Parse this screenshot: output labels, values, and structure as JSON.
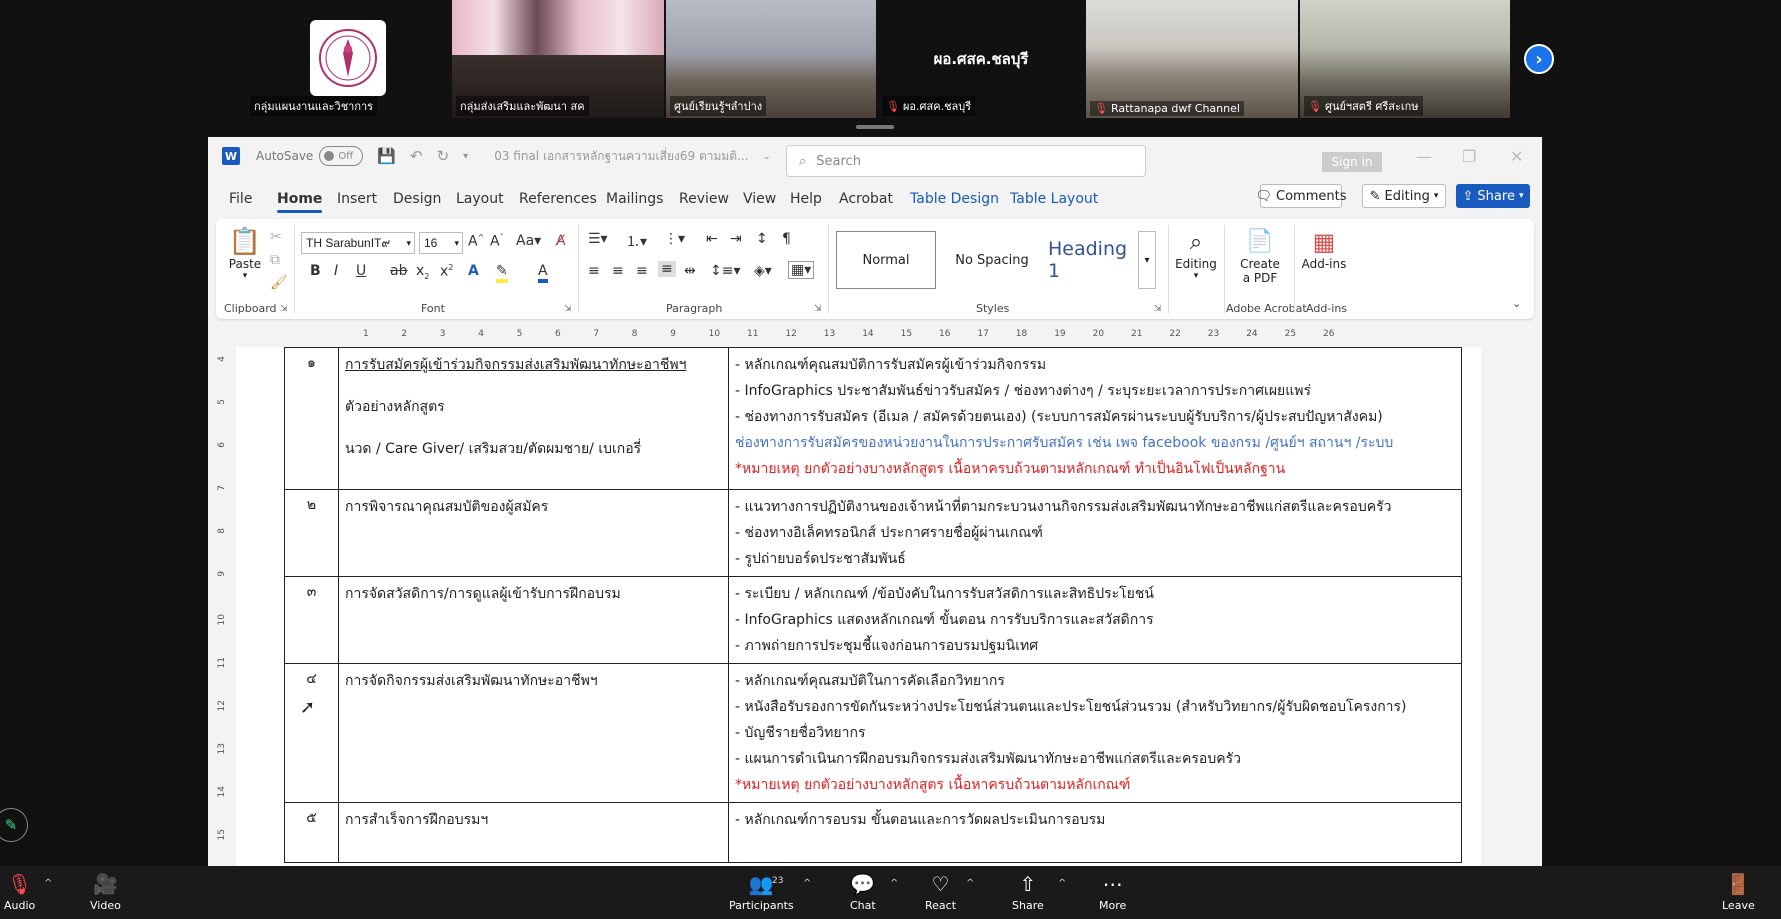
{
  "zoom": {
    "participants": [
      {
        "name": "กลุ่มแผนงานและวิชาการ",
        "muted": false,
        "kind": "logo"
      },
      {
        "name": "กลุ่มส่งเสริมและพัฒนา สค",
        "muted": false,
        "kind": "video",
        "active": true
      },
      {
        "name": "ศูนย์เรียนรู้ฯลำปาง",
        "muted": false,
        "kind": "video"
      },
      {
        "name": "ผอ.ศสค.ชลบุรี",
        "muted": true,
        "kind": "name",
        "display": "ผอ.ศสค.ชลบุรี"
      },
      {
        "name": "Rattanapa dwf Channel",
        "muted": true,
        "kind": "video"
      },
      {
        "name": "ศูนย์ฯสตรี ศรีสะเกษ",
        "muted": true,
        "kind": "video"
      }
    ],
    "bottom_bar": {
      "audio": "Audio",
      "video": "Video",
      "participants": "Participants",
      "participants_count": "23",
      "chat": "Chat",
      "react": "React",
      "share": "Share",
      "more": "More",
      "leave": "Leave"
    }
  },
  "word": {
    "autosave_label": "AutoSave",
    "autosave_state": "Off",
    "doc_title": "03 final เอกสารหลักฐานความเสี่ยง69 ตามมติ...",
    "search_placeholder": "Search",
    "sign_in": "Sign in",
    "menu": [
      "File",
      "Home",
      "Insert",
      "Design",
      "Layout",
      "References",
      "Mailings",
      "Review",
      "View",
      "Help",
      "Acrobat",
      "Table Design",
      "Table Layout"
    ],
    "comments": "Comments",
    "editing": "Editing",
    "share": "Share",
    "ribbon": {
      "paste": "Paste",
      "clipboard": "Clipboard",
      "font_name": "TH SarabunIT๙",
      "font_size": "16",
      "font": "Font",
      "paragraph": "Paragraph",
      "styles": "Styles",
      "style_normal": "Normal",
      "style_nospacing": "No Spacing",
      "style_heading1": "Heading 1",
      "editing": "Editing",
      "create_pdf_1": "Create",
      "create_pdf_2": "a PDF",
      "adobe_acrobat": "Adobe Acrobat",
      "addins": "Add-ins",
      "addins_group": "Add-ins"
    },
    "ruler_ticks": [
      "1",
      "2",
      "3",
      "4",
      "5",
      "6",
      "7",
      "8",
      "9",
      "10",
      "11",
      "12",
      "13",
      "14",
      "15",
      "16",
      "17",
      "18",
      "19",
      "20",
      "21",
      "22",
      "23",
      "24",
      "25",
      "26"
    ],
    "vruler_ticks": [
      "4",
      "5",
      "6",
      "7",
      "8",
      "9",
      "10",
      "11",
      "12",
      "13",
      "14",
      "15"
    ],
    "table": [
      {
        "num": "๑",
        "topic": [
          {
            "text": "การรับสมัครผู้เข้าร่วมกิจกรรมส่งเสริมพัฒนาทักษะอาชีพฯ",
            "style": "uline"
          },
          {
            "text": "ตัวอย่างหลักสูตร",
            "style": ""
          },
          {
            "text": "นวด / Care Giver/ เสริมสวย/ตัดผมชาย/ เบเกอรี่",
            "style": ""
          }
        ],
        "details": [
          {
            "text": "- หลักเกณฑ์คุณสมบัติการรับสมัครผู้เข้าร่วมกิจกรรม",
            "color": ""
          },
          {
            "text": "- InfoGraphics ประชาสัมพันธ์ข่าวรับสมัคร / ช่องทางต่างๆ / ระบุระยะเวลาการประกาศเผยแพร่",
            "color": ""
          },
          {
            "text": "- ช่องทางการรับสมัคร (อีเมล / สมัครด้วยตนเอง) (ระบบการสมัครผ่านระบบผู้รับบริการ/ผู้ประสบปัญหาสังคม)",
            "color": ""
          },
          {
            "text": "ช่องทางการรับสมัครของหน่วยงานในการประกาศรับสมัคร เช่น เพจ facebook ของกรม /ศูนย์ฯ สถานฯ /ระบบ",
            "color": "blue"
          },
          {
            "text": "*หมายเหตุ ยกตัวอย่างบางหลักสูตร เนื้อหาครบถ้วนตามหลักเกณฑ์ ทำเป็นอินโฟเป็นหลักฐาน",
            "color": "red"
          }
        ]
      },
      {
        "num": "๒",
        "topic": [
          {
            "text": "การพิจารณาคุณสมบัติของผู้สมัคร",
            "style": ""
          }
        ],
        "details": [
          {
            "text": "- แนวทางการปฏิบัติงานของเจ้าหน้าที่ตามกระบวนงานกิจกรรมส่งเสริมพัฒนาทักษะอาชีพแก่สตรีและครอบครัว",
            "color": ""
          },
          {
            "text": "- ช่องทางอิเล็คทรอนิกส์ ประกาศรายชื่อผู้ผ่านเกณฑ์",
            "color": ""
          },
          {
            "text": "- รูปถ่ายบอร์ดประชาสัมพันธ์",
            "color": ""
          }
        ]
      },
      {
        "num": "๓",
        "topic": [
          {
            "text": "การจัดสวัสดิการ/การดูแลผู้เข้ารับการฝึกอบรม",
            "style": ""
          }
        ],
        "details": [
          {
            "text": "- ระเบียบ / หลักเกณฑ์ /ข้อบังคับในการรับสวัสดิการและสิทธิประโยชน์",
            "color": ""
          },
          {
            "text": "- InfoGraphics แสดงหลักเกณฑ์ ขั้นตอน การรับบริการและสวัสดิการ",
            "color": ""
          },
          {
            "text": "- ภาพถ่ายการประชุมชี้แจงก่อนการอบรมปฐมนิเทศ",
            "color": ""
          }
        ]
      },
      {
        "num": "๔",
        "topic": [
          {
            "text": "การจัดกิจกรรมส่งเสริมพัฒนาทักษะอาชีพฯ",
            "style": ""
          }
        ],
        "details": [
          {
            "text": "- หลักเกณฑ์คุณสมบัติในการคัดเลือกวิทยากร",
            "color": ""
          },
          {
            "text": "- หนังสือรับรองการขัดกันระหว่างประโยชน์ส่วนตนและประโยชน์ส่วนรวม (สำหรับวิทยากร/ผู้รับผิดชอบโครงการ)",
            "color": ""
          },
          {
            "text": "- บัญชีรายชื่อวิทยากร",
            "color": ""
          },
          {
            "text": "- แผนการดำเนินการฝึกอบรมกิจกรรมส่งเสริมพัฒนาทักษะอาชีพแก่สตรีและครอบครัว",
            "color": ""
          },
          {
            "text": "*หมายเหตุ ยกตัวอย่างบางหลักสูตร เนื้อหาครบถ้วนตามหลักเกณฑ์",
            "color": "red"
          }
        ]
      },
      {
        "num": "๕",
        "topic": [
          {
            "text": "การสำเร็จการฝึกอบรมฯ",
            "style": ""
          }
        ],
        "details": [
          {
            "text": "- หลักเกณฑ์การอบรม ขั้นตอนและการวัดผลประเมินการอบรม",
            "color": ""
          }
        ]
      }
    ]
  }
}
